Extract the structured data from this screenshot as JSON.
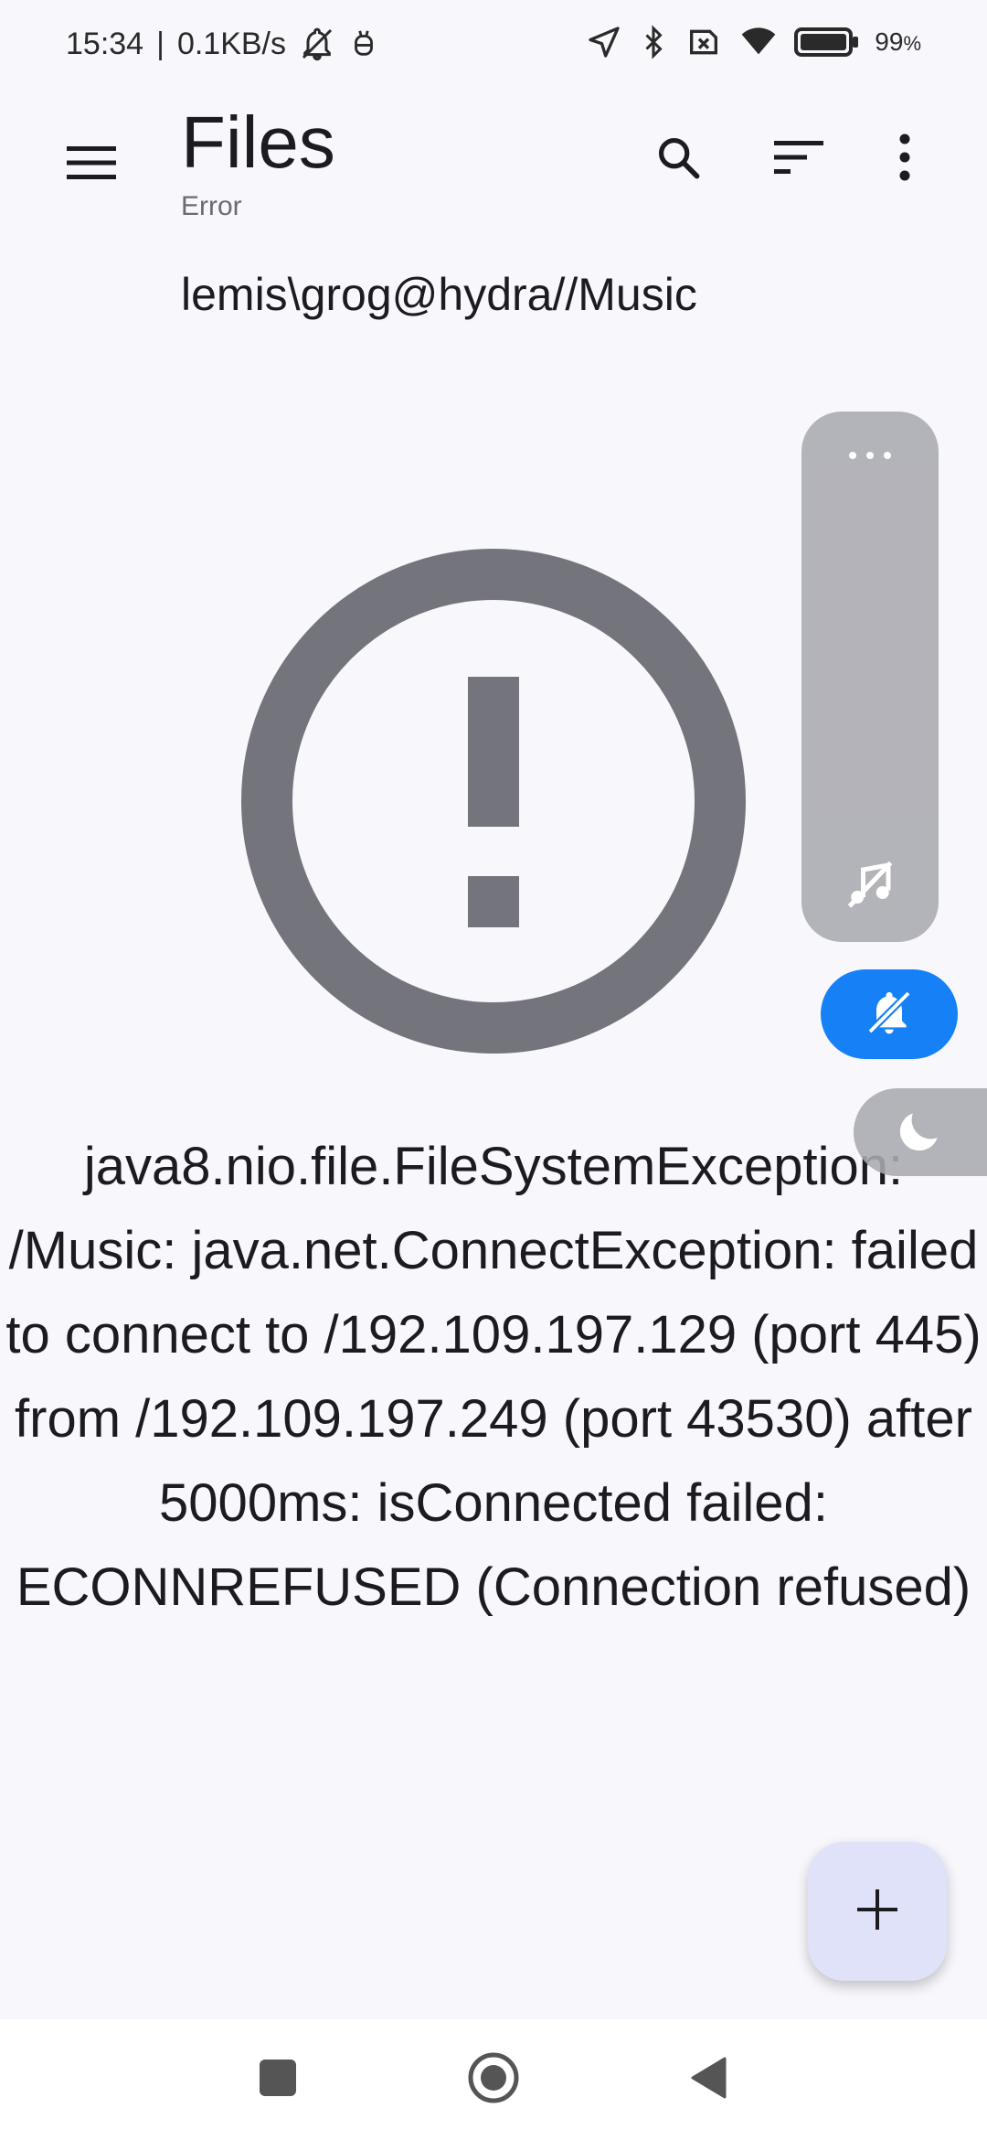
{
  "status_bar": {
    "time": "15:34",
    "separator": "|",
    "network_speed": "0.1KB/s",
    "battery_percent": "99",
    "battery_unit": "%",
    "icons": [
      "mute-notifications-icon",
      "android-debug-icon",
      "location-arrow-icon",
      "bluetooth-icon",
      "sim-icon",
      "wifi-icon",
      "battery-icon"
    ]
  },
  "app_bar": {
    "title": "Files",
    "subtitle": "Error",
    "icons": [
      "menu-icon",
      "search-icon",
      "sort-icon",
      "more-vert-icon"
    ]
  },
  "breadcrumb": {
    "path": "lemis\\grog@hydra//Music"
  },
  "error": {
    "icon": "error-outline-icon",
    "message": "java8.nio.file.FileSystemException: /Music: java.net.ConnectException: failed to connect to /192.109.197.129 (port 445) from /192.109.197.249 (port 43530) after 5000ms: isConnected failed: ECONNREFUSED (Connection refused)",
    "color": "#74747d"
  },
  "overlay_panel": {
    "icons": [
      "more-horiz-icon",
      "music-off-icon",
      "bell-off-icon",
      "moon-icon"
    ],
    "mute_toggle_color": "#1680f7"
  },
  "fab": {
    "icon": "add-icon",
    "color": "#dfe2f8"
  },
  "nav_bar": {
    "icons": [
      "recents-square-icon",
      "home-circle-icon",
      "back-triangle-icon"
    ]
  }
}
